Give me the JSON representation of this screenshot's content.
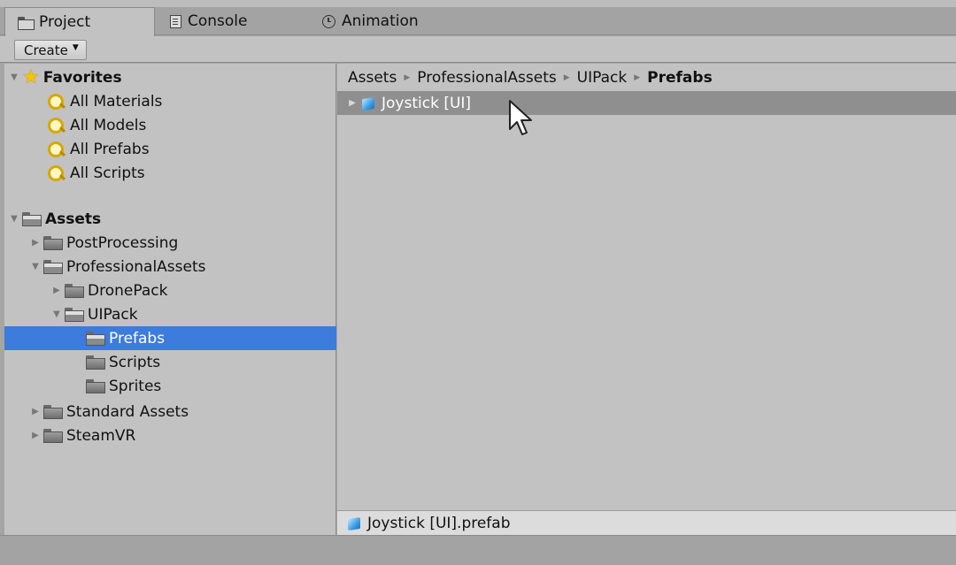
{
  "tabs": [
    {
      "label": "Project",
      "icon": "project-folder-icon",
      "active": true
    },
    {
      "label": "Console",
      "icon": "console-icon",
      "active": false
    },
    {
      "label": "Animation",
      "icon": "clock-icon",
      "active": false
    }
  ],
  "toolbar": {
    "create_label": "Create"
  },
  "favorites": {
    "title": "Favorites",
    "items": [
      "All Materials",
      "All Models",
      "All Prefabs",
      "All Scripts"
    ]
  },
  "assets": {
    "title": "Assets",
    "items": [
      {
        "label": "PostProcessing"
      },
      {
        "label": "ProfessionalAssets"
      },
      {
        "label": "DronePack"
      },
      {
        "label": "UIPack"
      },
      {
        "label": "Prefabs",
        "selected": true
      },
      {
        "label": "Scripts"
      },
      {
        "label": "Sprites"
      },
      {
        "label": "Standard Assets"
      },
      {
        "label": "SteamVR"
      }
    ]
  },
  "breadcrumb": [
    "Assets",
    "ProfessionalAssets",
    "UIPack",
    "Prefabs"
  ],
  "content": {
    "items": [
      "Joystick [UI]"
    ]
  },
  "status": {
    "selected_file": "Joystick [UI].prefab"
  },
  "colors": {
    "selection": "#3d7bdc",
    "panel": "#c2c2c2",
    "hover_row": "#8f8f8f"
  }
}
